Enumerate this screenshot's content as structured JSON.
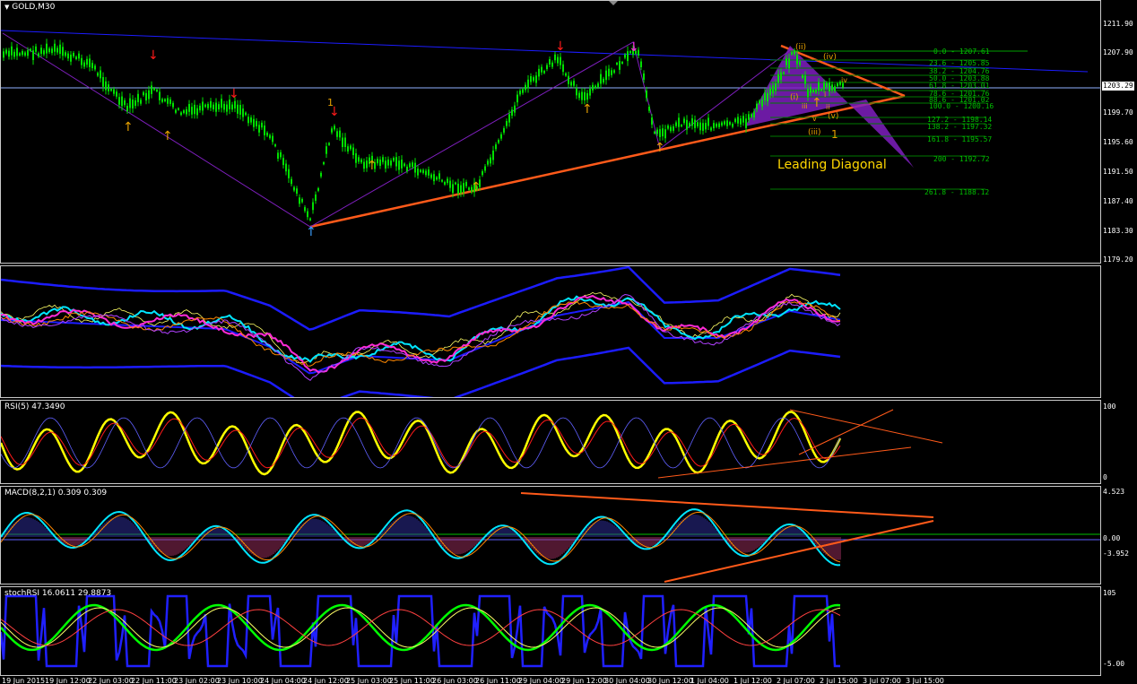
{
  "symbol_label": "GOLD,M30",
  "price_pane": {
    "scale": [
      "1211.90",
      "1207.90",
      "1203.29",
      "1199.70",
      "1195.60",
      "1191.50",
      "1187.40",
      "1183.30",
      "1179.20"
    ],
    "current_price": "1203.29",
    "fib_levels": [
      "0.0 - 1207.61",
      "23.6 - 1205.85",
      "38.2 - 1204.76",
      "50.0 - 1203.88",
      "61.8 - 1203.01",
      "78.6 - 1201.76",
      "88.6 - 1201.02",
      "100.0 - 1200.16",
      "127.2 - 1198.14",
      "138.2 - 1197.32",
      "161.8 - 1195.57",
      "200 - 1192.72",
      "261.8 - 1188.12"
    ],
    "wave_labels": [
      "1",
      "(ii)",
      "(iv)",
      "(i)",
      "iii",
      "iv",
      "ii",
      "v",
      "(v)",
      "(iii)",
      "1",
      "i"
    ],
    "annotation": "Leading Diagonal"
  },
  "bands_pane": {},
  "rsi_pane": {
    "label": "RSI(5) 47.3490",
    "scale": [
      "100",
      "0"
    ]
  },
  "macd_pane": {
    "label": "MACD(8,2,1) 0.309 0.309",
    "scale": [
      "4.523",
      "0.00",
      "-3.952"
    ]
  },
  "stoch_pane": {
    "label": "stochRSI 16.0611 29.8873",
    "scale": [
      "105",
      "-5.00"
    ]
  },
  "time_axis": [
    "19 Jun 2015",
    "19 Jun 12:00",
    "22 Jun 03:00",
    "22 Jun 11:00",
    "23 Jun 02:00",
    "23 Jun 10:00",
    "24 Jun 04:00",
    "24 Jun 12:00",
    "25 Jun 03:00",
    "25 Jun 11:00",
    "26 Jun 03:00",
    "26 Jun 11:00",
    "29 Jun 04:00",
    "29 Jun 12:00",
    "30 Jun 04:00",
    "30 Jun 12:00",
    "1 Jul 04:00",
    "1 Jul 12:00",
    "2 Jul 07:00",
    "2 Jul 15:00",
    "3 Jul 07:00",
    "3 Jul 15:00"
  ],
  "colors": {
    "bull": "#00e000",
    "bear": "#00e000",
    "trend_orange": "#ff5a1a",
    "purple": "#7f1fbf",
    "blue": "#1c1cff",
    "yellow": "#ffff00",
    "cyan": "#00e5ff",
    "magenta": "#ff2bd6",
    "red": "#ff1a1a"
  }
}
